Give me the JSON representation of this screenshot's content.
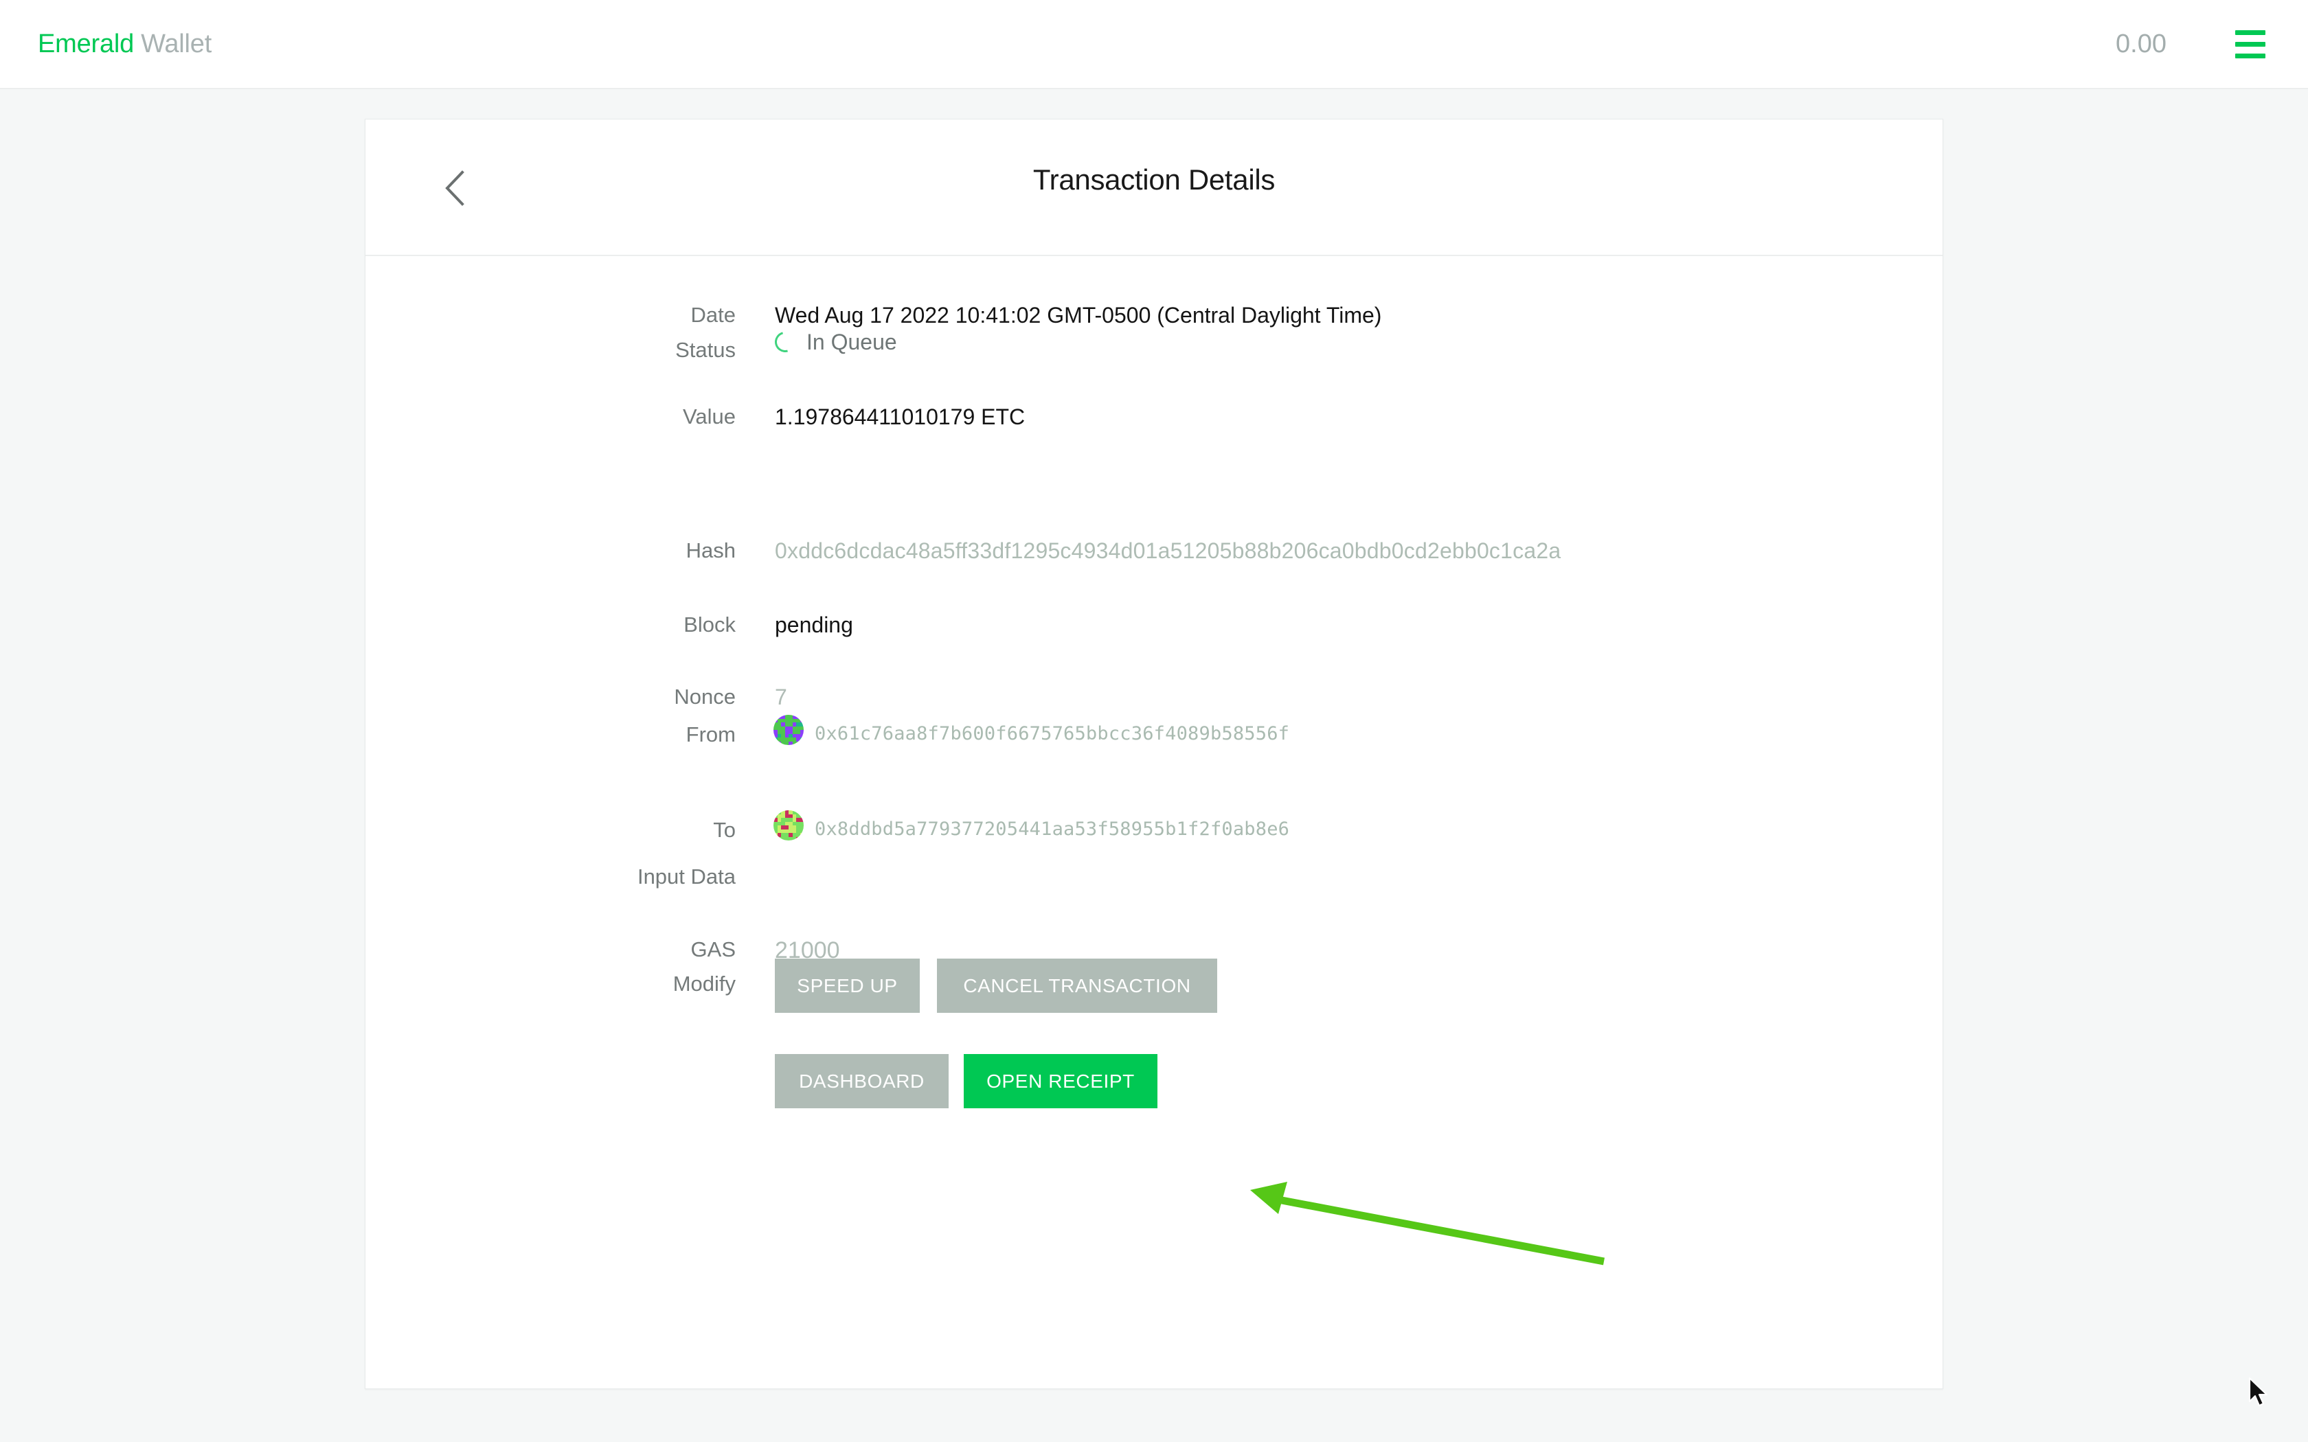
{
  "app_bar": {
    "brand_primary": "Emerald",
    "brand_secondary": "Wallet",
    "balance": "0.00",
    "menu_icon": "hamburger-menu-icon"
  },
  "card": {
    "title": "Transaction Details",
    "back_icon": "chevron-left-icon"
  },
  "details": {
    "labels": {
      "date": "Date",
      "status": "Status",
      "value": "Value",
      "hash": "Hash",
      "block": "Block",
      "nonce": "Nonce",
      "from": "From",
      "to": "To",
      "input_data": "Input Data",
      "gas": "GAS",
      "modify": "Modify"
    },
    "values": {
      "date": "Wed Aug 17 2022 10:41:02 GMT-0500 (Central Daylight Time)",
      "status": "In Queue",
      "status_icon": "spinner-icon",
      "value": "1.197864411010179 ETC",
      "hash": "0xddc6dcdac48a5ff33df1295c4934d01a51205b88b206ca0bdb0cd2ebb0c1ca2a",
      "block": "pending",
      "nonce": "7",
      "from": "0x61c76aa8f7b600f6675765bbcc36f4089b58556f",
      "to": "0x8ddbd5a779377205441aa53f58955b1f2f0ab8e6",
      "input_data": "",
      "gas": "21000"
    }
  },
  "buttons": {
    "speed_up": "SPEED UP",
    "cancel_transaction": "CANCEL TRANSACTION",
    "dashboard": "DASHBOARD",
    "open_receipt": "OPEN RECEIPT"
  },
  "annotation": {
    "arrow_icon": "green-arrow-pointing-left",
    "color": "#56c717"
  },
  "colors": {
    "brand_green": "#00c853",
    "accent_green": "#00c853",
    "muted_grey": "#b0bcb6",
    "page_background": "#f5f7f7",
    "card_background": "#ffffff",
    "label_text": "#747a7a",
    "value_text": "#141414",
    "hash_text": "#aebcb4"
  },
  "identicons": {
    "from": {
      "bg": "#8a3ffb",
      "fg": "#4ec74e",
      "accent": "#1fb98a",
      "grid": [
        [
          0,
          0,
          0,
          1,
          1,
          0,
          0,
          0
        ],
        [
          0,
          1,
          1,
          1,
          1,
          1,
          1,
          0
        ],
        [
          1,
          1,
          0,
          1,
          1,
          0,
          2,
          2
        ],
        [
          1,
          1,
          1,
          0,
          0,
          1,
          1,
          1
        ],
        [
          0,
          1,
          1,
          0,
          0,
          1,
          1,
          0
        ],
        [
          0,
          2,
          1,
          0,
          2,
          0,
          0,
          0
        ],
        [
          2,
          1,
          1,
          1,
          1,
          1,
          0,
          2
        ],
        [
          0,
          0,
          1,
          1,
          0,
          1,
          1,
          0
        ]
      ]
    },
    "to": {
      "bg": "#c8f06a",
      "fg": "#77e060",
      "accent": "#c9305d",
      "grid": [
        [
          1,
          1,
          0,
          2,
          0,
          1,
          1,
          1
        ],
        [
          1,
          0,
          0,
          2,
          2,
          0,
          1,
          1
        ],
        [
          2,
          0,
          1,
          1,
          1,
          0,
          2,
          2
        ],
        [
          1,
          1,
          1,
          0,
          0,
          1,
          1,
          1
        ],
        [
          1,
          0,
          2,
          2,
          0,
          0,
          1,
          1
        ],
        [
          1,
          0,
          0,
          0,
          0,
          0,
          1,
          1
        ],
        [
          0,
          2,
          1,
          1,
          2,
          1,
          1,
          0
        ],
        [
          1,
          1,
          1,
          1,
          1,
          1,
          2,
          1
        ]
      ]
    }
  },
  "cursor": {
    "icon": "mouse-pointer-icon"
  }
}
